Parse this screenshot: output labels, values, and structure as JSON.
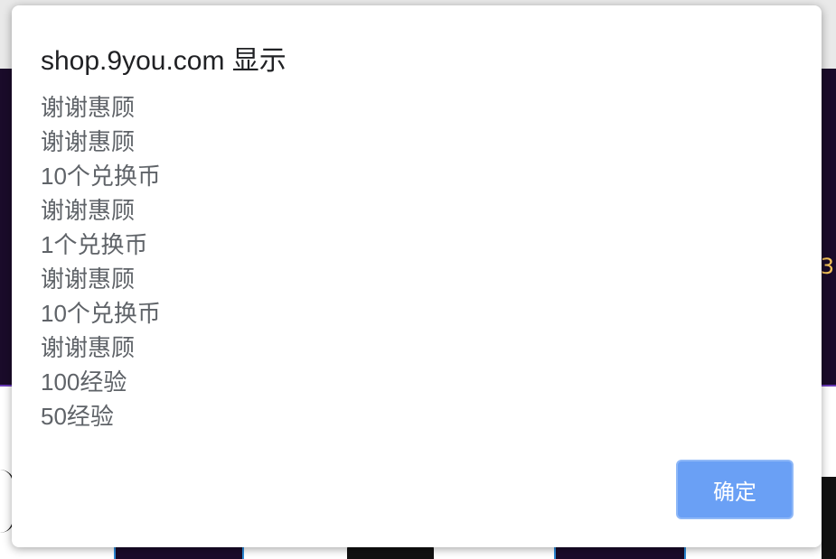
{
  "dialog": {
    "title": "shop.9you.com 显示",
    "messages": [
      "谢谢惠顾",
      "谢谢惠顾",
      "10个兑换币",
      "谢谢惠顾",
      "1个兑换币",
      "谢谢惠顾",
      "10个兑换币",
      "谢谢惠顾",
      "100经验",
      "50经验"
    ],
    "ok_label": "确定"
  },
  "background": {
    "banner_text": "3"
  },
  "colors": {
    "ok_button": "#6aa0f5",
    "title_text": "#202124",
    "message_text": "#5f6368",
    "banner_bg": "#1a0b2a",
    "banner_accent": "#f4c45a"
  }
}
